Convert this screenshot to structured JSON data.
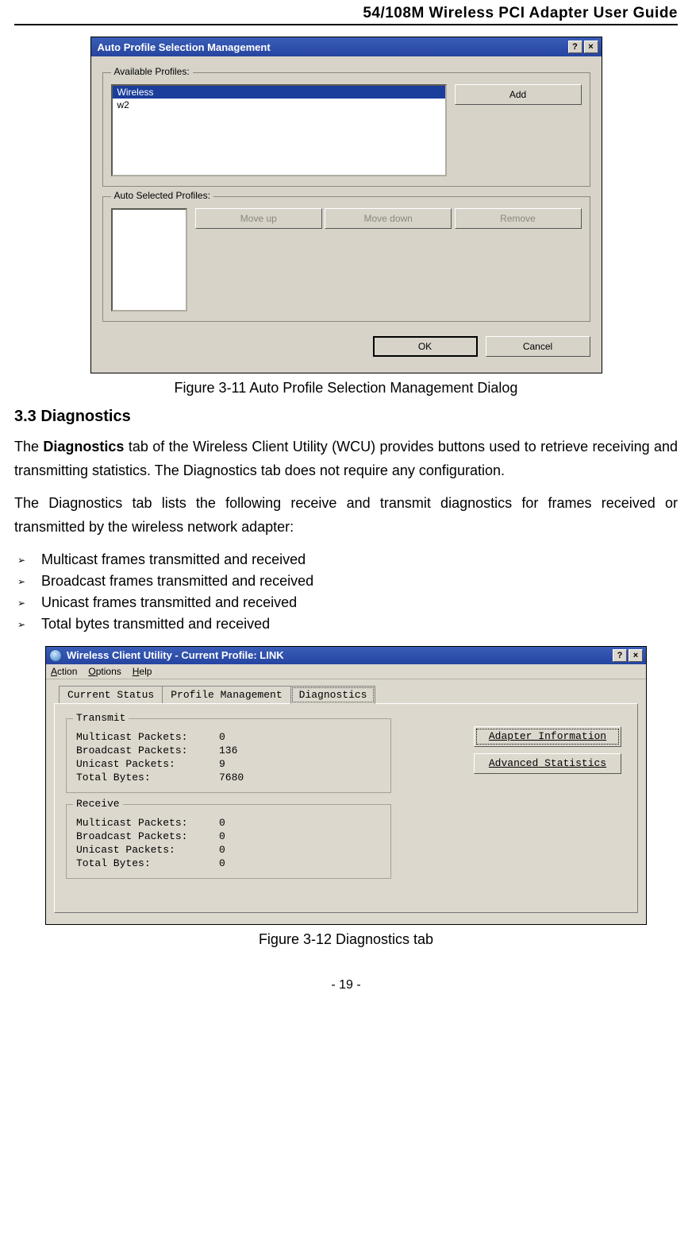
{
  "header_title": "54/108M Wireless PCI Adapter User Guide",
  "figure311": {
    "dialog_title": "Auto Profile Selection Management",
    "group_available": "Available Profiles:",
    "group_selected": "Auto Selected Profiles:",
    "profiles": [
      "Wireless",
      "w2"
    ],
    "btn_add": "Add",
    "btn_moveup": "Move up",
    "btn_movedown": "Move down",
    "btn_remove": "Remove",
    "btn_ok": "OK",
    "btn_cancel": "Cancel",
    "caption": "Figure 3-11    Auto Profile Selection Management Dialog"
  },
  "section_heading": "3.3 Diagnostics",
  "para1_pre": "The ",
  "para1_bold": "Diagnostics",
  "para1_post": " tab of the Wireless Client Utility (WCU) provides buttons used to retrieve receiving and transmitting statistics. The Diagnostics tab does not require any configuration.",
  "para2": "The Diagnostics tab lists the following receive and transmit diagnostics for frames received or transmitted by the wireless network adapter:",
  "bullets": [
    "Multicast frames transmitted and received",
    "Broadcast frames transmitted and received",
    "Unicast frames transmitted and received",
    "Total bytes transmitted and received"
  ],
  "figure312": {
    "dialog_title": "Wireless Client Utility - Current Profile: LINK",
    "menus": [
      "Action",
      "Options",
      "Help"
    ],
    "tabs": [
      "Current Status",
      "Profile Management",
      "Diagnostics"
    ],
    "transmit_label": "Transmit",
    "receive_label": "Receive",
    "rows_tx": [
      {
        "label": "Multicast Packets:",
        "value": "0"
      },
      {
        "label": "Broadcast Packets:",
        "value": "136"
      },
      {
        "label": "Unicast Packets:",
        "value": "9"
      },
      {
        "label": "Total Bytes:",
        "value": "7680"
      }
    ],
    "rows_rx": [
      {
        "label": "Multicast Packets:",
        "value": "0"
      },
      {
        "label": "Broadcast Packets:",
        "value": "0"
      },
      {
        "label": "Unicast Packets:",
        "value": "0"
      },
      {
        "label": "Total Bytes:",
        "value": "0"
      }
    ],
    "btn_adapter": "Adapter Information",
    "btn_advanced": "Advanced Statistics",
    "caption": "Figure 3-12    Diagnostics tab"
  },
  "page_number": "- 19 -"
}
